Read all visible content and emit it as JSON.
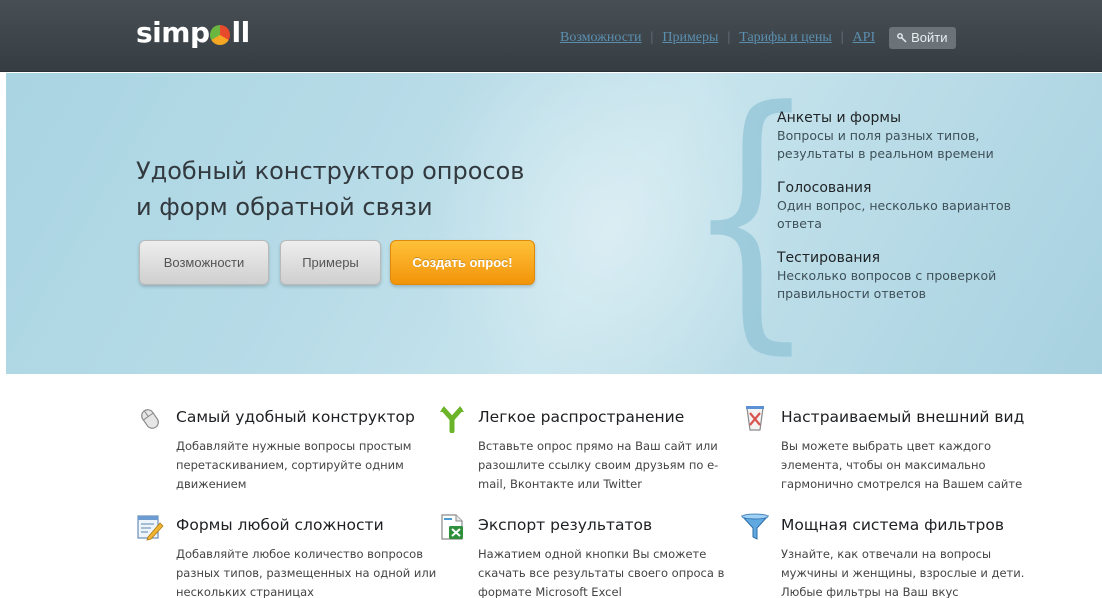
{
  "header": {
    "logo": "simpoll",
    "nav": [
      {
        "label": "Возможности"
      },
      {
        "label": "Примеры"
      },
      {
        "label": "Тарифы и цены"
      },
      {
        "label": "API"
      }
    ],
    "separator": "|",
    "login_label": "Войти",
    "colors": {
      "bar": "#3f474c",
      "link": "#5b8fb0"
    }
  },
  "hero": {
    "title_line1": "Удобный конструктор опросов",
    "title_line2": "и форм обратной связи",
    "buttons": {
      "features": "Возможности",
      "examples": "Примеры",
      "create": "Создать опрос!"
    },
    "features": [
      {
        "title": "Анкеты и формы",
        "text": "Вопросы и поля разных типов, результаты в реальном времени"
      },
      {
        "title": "Голосования",
        "text": "Один вопрос, несколько вариантов ответа"
      },
      {
        "title": "Тестирования",
        "text": "Несколько вопросов с проверкой правильности ответов"
      }
    ],
    "colors": {
      "background": "#b8dce8",
      "accent": "#f29409"
    }
  },
  "grid": [
    {
      "icon": "mouse-icon",
      "title": "Самый удобный конструктор",
      "text": "Добавляйте нужные вопросы простым перетаскиванием, сортируйте одним движением"
    },
    {
      "icon": "share-arrows-icon",
      "title": "Легкое распространение",
      "text": "Вставьте опрос прямо на Ваш сайт или разошлите ссылку своим друзьям по e-mail, Вконтакте или Twitter"
    },
    {
      "icon": "paint-icon",
      "title": "Настраиваемый внешний вид",
      "text": "Вы можете выбрать цвет каждого элемента, чтобы он максимально гармонично смотрелся на Вашем сайте"
    },
    {
      "icon": "form-edit-icon",
      "title": "Формы любой сложности",
      "text": "Добавляйте любое количество вопросов разных типов, размещенных на одной или нескольких страницах"
    },
    {
      "icon": "excel-export-icon",
      "title": "Экспорт результатов",
      "text": "Нажатием одной кнопки Вы сможете скачать все результаты своего опроса в формате Microsoft Excel"
    },
    {
      "icon": "filter-icon",
      "title": "Мощная система фильтров",
      "text": "Узнайте, как отвечали на вопросы мужчины и женщины, взрослые и дети. Любые фильтры на Ваш вкус"
    }
  ]
}
